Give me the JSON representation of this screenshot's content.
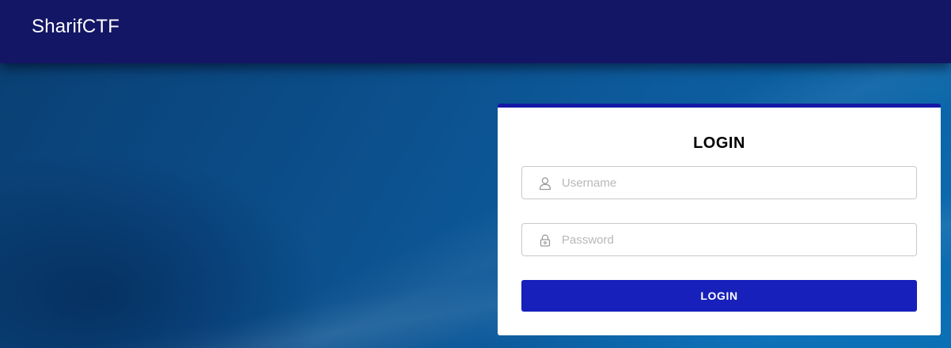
{
  "header": {
    "brand": "SharifCTF"
  },
  "login_card": {
    "title": "LOGIN",
    "username": {
      "icon": "user-icon",
      "placeholder": "Username",
      "value": ""
    },
    "password": {
      "icon": "lock-icon",
      "placeholder": "Password",
      "value": ""
    },
    "submit_label": "LOGIN"
  },
  "colors": {
    "header_bg": "#131664",
    "accent": "#1519a6",
    "button_bg": "#1720bb",
    "background": "#0b4b86"
  }
}
